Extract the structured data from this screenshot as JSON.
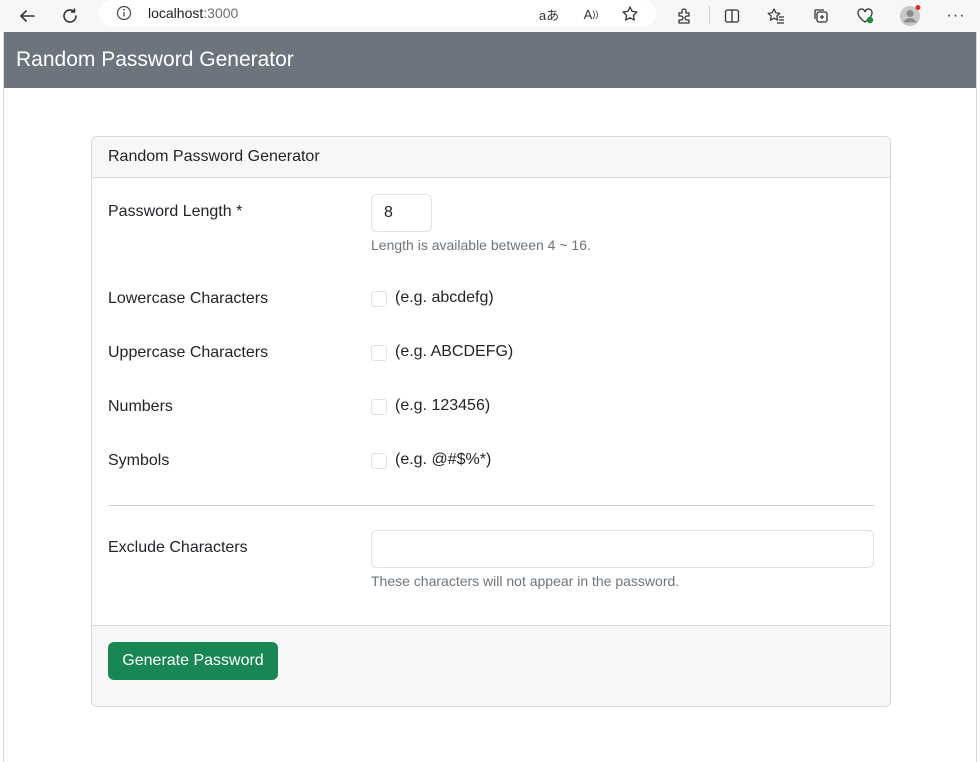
{
  "browser": {
    "url_host": "localhost",
    "url_port": ":3000"
  },
  "navbar": {
    "title": "Random Password Generator"
  },
  "card": {
    "header": "Random Password Generator",
    "length": {
      "label": "Password Length *",
      "value": "8",
      "help": "Length is available between 4 ~ 16."
    },
    "options": [
      {
        "label": "Lowercase Characters",
        "example": "(e.g. abcdefg)",
        "checked": false
      },
      {
        "label": "Uppercase Characters",
        "example": "(e.g. ABCDEFG)",
        "checked": false
      },
      {
        "label": "Numbers",
        "example": "(e.g. 123456)",
        "checked": false
      },
      {
        "label": "Symbols",
        "example": "(e.g. @#$%*)",
        "checked": false
      }
    ],
    "exclude": {
      "label": "Exclude Characters",
      "value": "",
      "help": "These characters will not appear in the password."
    },
    "generate_label": "Generate Password"
  },
  "colors": {
    "navbar": "#6c757d",
    "button": "#198754"
  }
}
